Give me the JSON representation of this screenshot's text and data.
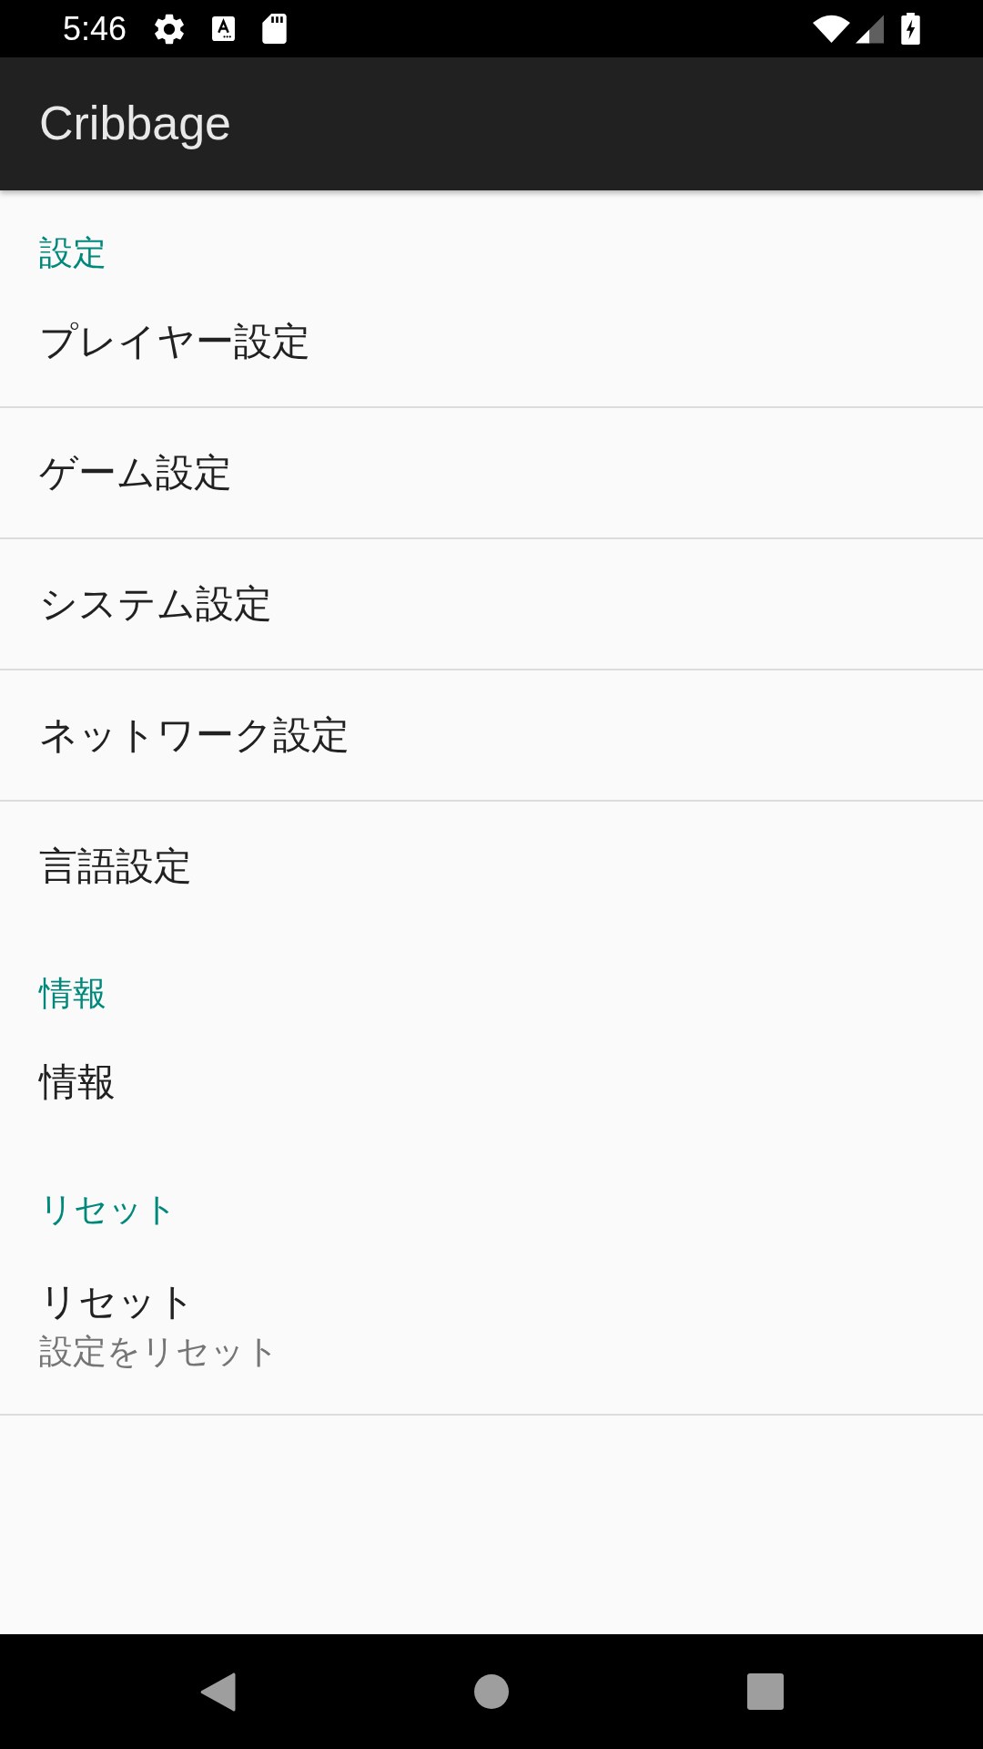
{
  "status_bar": {
    "time": "5:46"
  },
  "app_bar": {
    "title": "Cribbage"
  },
  "categories": [
    {
      "title": "設定",
      "items": [
        {
          "title": "プレイヤー設定"
        },
        {
          "title": "ゲーム設定"
        },
        {
          "title": "システム設定"
        },
        {
          "title": "ネットワーク設定"
        },
        {
          "title": "言語設定"
        }
      ]
    },
    {
      "title": "情報",
      "items": [
        {
          "title": "情報"
        }
      ]
    },
    {
      "title": "リセット",
      "items": [
        {
          "title": "リセット",
          "summary": "設定をリセット"
        }
      ]
    }
  ]
}
